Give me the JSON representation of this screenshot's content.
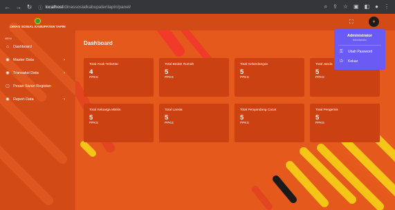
{
  "browser": {
    "url_host": "localhost",
    "url_path": "/dinassosialkabupatentapin/panel/"
  },
  "brand": {
    "name": "DINAS SOSIAL KABUPATEN TAPIN"
  },
  "sidebar": {
    "section_label": "MENU",
    "items": [
      {
        "label": "Dashboard",
        "icon": "home-icon",
        "has_children": false
      },
      {
        "label": "Master Data",
        "icon": "circle-icon",
        "has_children": true
      },
      {
        "label": "Transaksi Data",
        "icon": "circle-icon",
        "has_children": true
      },
      {
        "label": "Pesan Saran Registan",
        "icon": "message-icon",
        "has_children": false
      },
      {
        "label": "Report Data",
        "icon": "circle-icon",
        "has_children": true
      }
    ]
  },
  "main": {
    "title": "Dashboard",
    "cards": [
      {
        "title": "Total Anak Terlantar",
        "value": "4",
        "unit": "PPKS"
      },
      {
        "title": "Total Bedah Rumah",
        "value": "5",
        "unit": "PPKS"
      },
      {
        "title": "Total Gelandangan",
        "value": "5",
        "unit": "PPKS"
      },
      {
        "title": "Total Janda",
        "value": "5",
        "unit": "PPKS"
      },
      {
        "title": "Total Keluarga Miskin",
        "value": "5",
        "unit": "PPKS"
      },
      {
        "title": "Total Lansia",
        "value": "5",
        "unit": "PPKS"
      },
      {
        "title": "Total Penyandang Cacat",
        "value": "5",
        "unit": "PPKS"
      },
      {
        "title": "Total Pengemis",
        "value": "5",
        "unit": "PPKS"
      }
    ]
  },
  "user_menu": {
    "name": "Administrator",
    "role": "Administrator",
    "items": [
      {
        "label": "Ubah Password",
        "icon": "lock-icon"
      },
      {
        "label": "Keluar",
        "icon": "power-icon"
      }
    ]
  },
  "colors": {
    "primary": "#e55a1c",
    "sidebar": "#d24a16",
    "card": "#cc4111",
    "dropdown": "#6a5bf5",
    "accent_yellow": "#f5c518"
  }
}
